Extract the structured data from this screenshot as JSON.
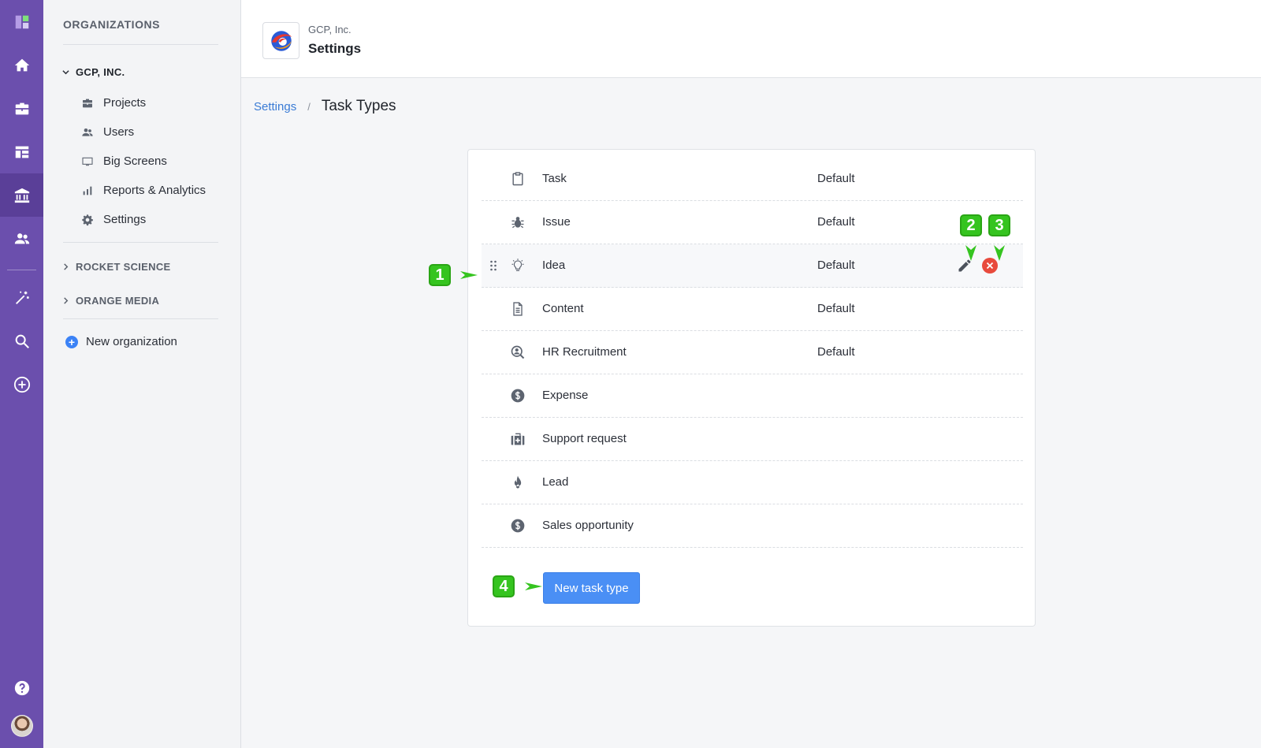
{
  "rail": {
    "icons": [
      "logo-icon",
      "home-icon",
      "briefcase-icon",
      "dashboard-icon",
      "bank-icon",
      "users-icon",
      "magic-wand-icon",
      "search-icon",
      "plus-circle-icon",
      "help-icon",
      "avatar"
    ]
  },
  "sidebar": {
    "title": "ORGANIZATIONS",
    "groups": [
      {
        "label": "GCP, INC.",
        "expanded": true
      },
      {
        "label": "ROCKET SCIENCE",
        "expanded": false
      },
      {
        "label": "ORANGE MEDIA",
        "expanded": false
      }
    ],
    "items": [
      {
        "label": "Projects",
        "icon": "briefcase-icon"
      },
      {
        "label": "Users",
        "icon": "users-icon"
      },
      {
        "label": "Big Screens",
        "icon": "monitor-icon"
      },
      {
        "label": "Reports & Analytics",
        "icon": "bar-chart-icon"
      },
      {
        "label": "Settings",
        "icon": "gear-icon"
      }
    ],
    "new_org_label": "New organization"
  },
  "header": {
    "org_name": "GCP, Inc.",
    "title": "Settings"
  },
  "breadcrumb": {
    "parent": "Settings",
    "separator": "/",
    "current": "Task Types"
  },
  "task_types": [
    {
      "name": "Task",
      "default": "Default",
      "icon": "clipboard-icon"
    },
    {
      "name": "Issue",
      "default": "Default",
      "icon": "bug-icon"
    },
    {
      "name": "Idea",
      "default": "Default",
      "icon": "lightbulb-icon"
    },
    {
      "name": "Content",
      "default": "Default",
      "icon": "document-icon"
    },
    {
      "name": "HR Recruitment",
      "default": "Default",
      "icon": "search-person-icon"
    },
    {
      "name": "Expense",
      "default": "",
      "icon": "dollar-icon"
    },
    {
      "name": "Support request",
      "default": "",
      "icon": "first-aid-icon"
    },
    {
      "name": "Lead",
      "default": "",
      "icon": "fire-icon"
    },
    {
      "name": "Sales opportunity",
      "default": "",
      "icon": "dollar-icon"
    }
  ],
  "new_task_type_label": "New task type",
  "callouts": [
    "1",
    "2",
    "3",
    "4"
  ],
  "colors": {
    "rail": "#6b4fad",
    "primary_button": "#4a8ff5",
    "link": "#3a7bd5",
    "delete": "#e84a3c",
    "callout": "#35c41f"
  }
}
